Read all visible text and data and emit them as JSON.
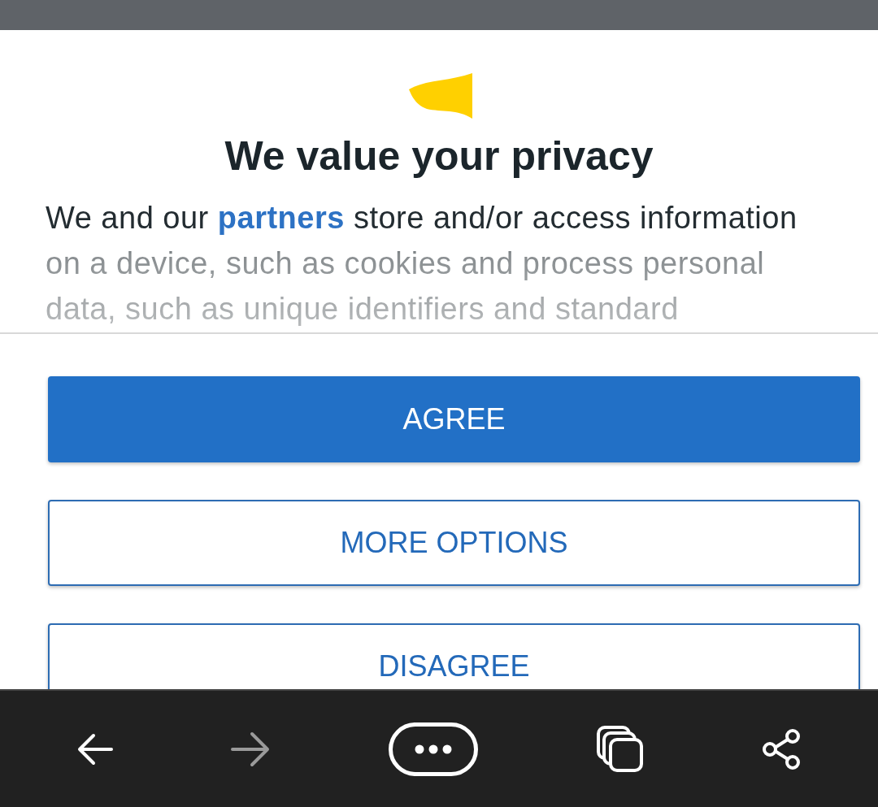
{
  "dialog": {
    "title": "We value your privacy",
    "intro": {
      "text_before": "We and our",
      "link": "partners",
      "text_after": "store and/or access information on a device, such as cookies and process personal data, such as unique identifiers and standard"
    },
    "buttons": [
      {
        "label": "AGREE",
        "kind": "filled"
      },
      {
        "label": "MORE OPTIONS",
        "kind": "outline"
      },
      {
        "label": "DISAGREE",
        "kind": "outline"
      }
    ]
  },
  "browser_bar": [
    {
      "kind": "back",
      "disabled": false
    },
    {
      "kind": "forward",
      "disabled": true
    },
    {
      "kind": "menu",
      "disabled": false
    },
    {
      "kind": "tabs",
      "disabled": false
    },
    {
      "kind": "share",
      "disabled": false
    }
  ]
}
